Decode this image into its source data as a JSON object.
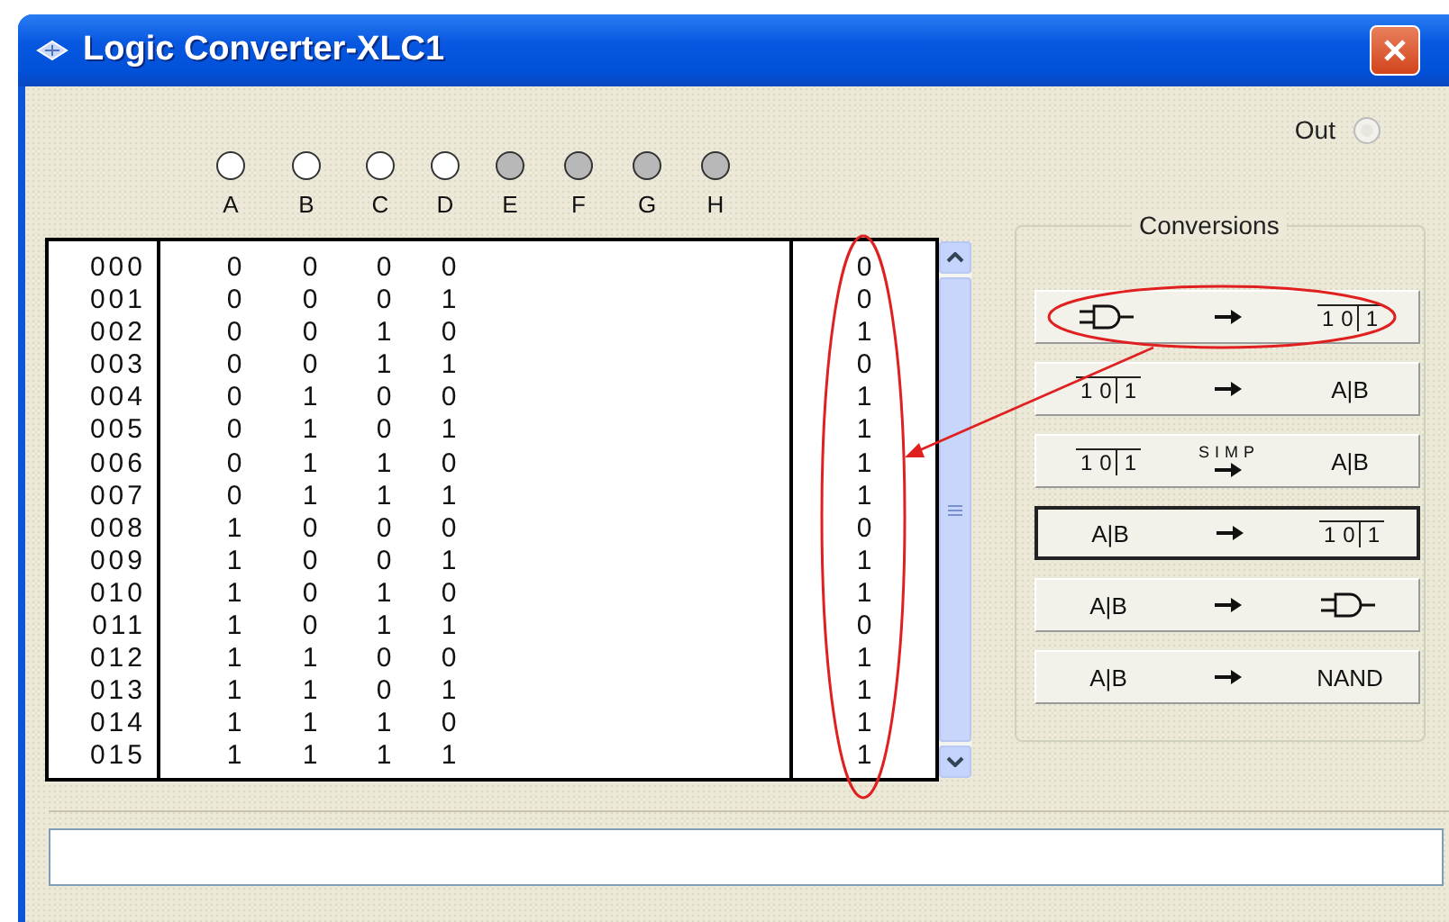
{
  "window": {
    "title": "Logic Converter-XLC1"
  },
  "out": {
    "label": "Out",
    "lit": false
  },
  "inputs": [
    {
      "label": "A",
      "active": true
    },
    {
      "label": "B",
      "active": true
    },
    {
      "label": "C",
      "active": true
    },
    {
      "label": "D",
      "active": true
    },
    {
      "label": "E",
      "active": false
    },
    {
      "label": "F",
      "active": false
    },
    {
      "label": "G",
      "active": false
    },
    {
      "label": "H",
      "active": false
    }
  ],
  "rows": [
    {
      "index": "000",
      "values": [
        "0",
        "0",
        "0",
        "0"
      ],
      "out": "0"
    },
    {
      "index": "001",
      "values": [
        "0",
        "0",
        "0",
        "1"
      ],
      "out": "0"
    },
    {
      "index": "002",
      "values": [
        "0",
        "0",
        "1",
        "0"
      ],
      "out": "1"
    },
    {
      "index": "003",
      "values": [
        "0",
        "0",
        "1",
        "1"
      ],
      "out": "0"
    },
    {
      "index": "004",
      "values": [
        "0",
        "1",
        "0",
        "0"
      ],
      "out": "1"
    },
    {
      "index": "005",
      "values": [
        "0",
        "1",
        "0",
        "1"
      ],
      "out": "1"
    },
    {
      "index": "006",
      "values": [
        "0",
        "1",
        "1",
        "0"
      ],
      "out": "1"
    },
    {
      "index": "007",
      "values": [
        "0",
        "1",
        "1",
        "1"
      ],
      "out": "1"
    },
    {
      "index": "008",
      "values": [
        "1",
        "0",
        "0",
        "0"
      ],
      "out": "0"
    },
    {
      "index": "009",
      "values": [
        "1",
        "0",
        "0",
        "1"
      ],
      "out": "1"
    },
    {
      "index": "010",
      "values": [
        "1",
        "0",
        "1",
        "0"
      ],
      "out": "1"
    },
    {
      "index": "011",
      "values": [
        "1",
        "0",
        "1",
        "1"
      ],
      "out": "0"
    },
    {
      "index": "012",
      "values": [
        "1",
        "1",
        "0",
        "0"
      ],
      "out": "1"
    },
    {
      "index": "013",
      "values": [
        "1",
        "1",
        "0",
        "1"
      ],
      "out": "1"
    },
    {
      "index": "014",
      "values": [
        "1",
        "1",
        "1",
        "0"
      ],
      "out": "1"
    },
    {
      "index": "015",
      "values": [
        "1",
        "1",
        "1",
        "1"
      ],
      "out": "1"
    }
  ],
  "conversions": {
    "title": "Conversions",
    "buttons": [
      {
        "from": {
          "kind": "gate"
        },
        "to": {
          "kind": "table",
          "text": "10",
          "tail": "1"
        },
        "selected": false
      },
      {
        "from": {
          "kind": "table",
          "text": "10",
          "tail": "1"
        },
        "to": {
          "kind": "text",
          "text": "A|B"
        },
        "selected": false
      },
      {
        "from": {
          "kind": "table",
          "text": "10",
          "tail": "1"
        },
        "via": "SIMP",
        "to": {
          "kind": "text",
          "text": "A|B"
        },
        "selected": false
      },
      {
        "from": {
          "kind": "text",
          "text": "A|B"
        },
        "to": {
          "kind": "table",
          "text": "10",
          "tail": "1"
        },
        "selected": true
      },
      {
        "from": {
          "kind": "text",
          "text": "A|B"
        },
        "to": {
          "kind": "gate"
        },
        "selected": false
      },
      {
        "from": {
          "kind": "text",
          "text": "A|B"
        },
        "to": {
          "kind": "text",
          "text": "NAND"
        },
        "selected": false
      }
    ]
  }
}
